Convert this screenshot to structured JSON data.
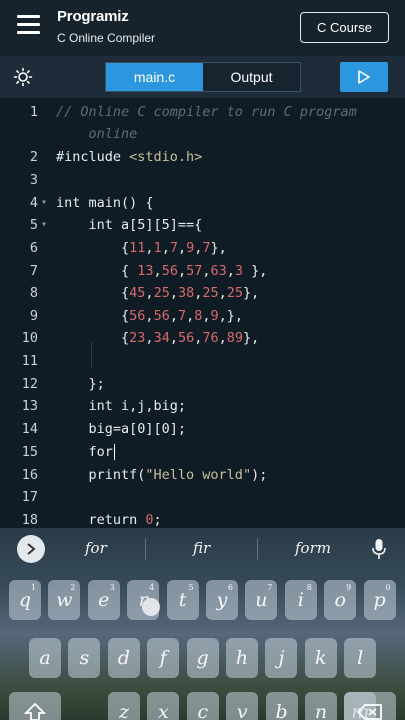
{
  "header": {
    "logo_text": "Programiz",
    "title": "C Online Compiler",
    "course_button": "C Course"
  },
  "toolbar": {
    "theme_icon": "sun-icon",
    "tabs": [
      {
        "label": "main.c",
        "active": true
      },
      {
        "label": "Output",
        "active": false
      }
    ],
    "run_icon": "play-icon",
    "accent_color": "#2c97de"
  },
  "editor": {
    "lines": [
      {
        "num": "1",
        "text": "// Online C compiler to run C program"
      },
      {
        "num": "",
        "text": "    online"
      },
      {
        "num": "2",
        "text": "#include <stdio.h>"
      },
      {
        "num": "3",
        "text": ""
      },
      {
        "num": "4",
        "text": "int main() {"
      },
      {
        "num": "5",
        "text": "    int a[5][5]=={"
      },
      {
        "num": "6",
        "text": "        {11,1,7,9,7},"
      },
      {
        "num": "7",
        "text": "        { 13,56,57,63,3 },"
      },
      {
        "num": "8",
        "text": "        {45,25,38,25,25},"
      },
      {
        "num": "9",
        "text": "        {56,56,7,8,9,},"
      },
      {
        "num": "10",
        "text": "        {23,34,56,76,89},"
      },
      {
        "num": "11",
        "text": ""
      },
      {
        "num": "12",
        "text": "    };"
      },
      {
        "num": "13",
        "text": "    int i,j,big;"
      },
      {
        "num": "14",
        "text": "    big=a[0][0];"
      },
      {
        "num": "15",
        "text": "    for"
      },
      {
        "num": "16",
        "text": "    printf(\"Hello world\");"
      },
      {
        "num": "17",
        "text": ""
      },
      {
        "num": "18",
        "text": "    return 0;"
      }
    ]
  },
  "keyboard": {
    "suggestions": [
      "for",
      "fir",
      "form"
    ],
    "row1": [
      {
        "k": "q",
        "h": "1"
      },
      {
        "k": "w",
        "h": "2"
      },
      {
        "k": "e",
        "h": "3"
      },
      {
        "k": "r",
        "h": "4"
      },
      {
        "k": "t",
        "h": "5"
      },
      {
        "k": "y",
        "h": "6"
      },
      {
        "k": "u",
        "h": "7"
      },
      {
        "k": "i",
        "h": "8"
      },
      {
        "k": "o",
        "h": "9"
      },
      {
        "k": "p",
        "h": "0"
      }
    ],
    "row2": [
      "a",
      "s",
      "d",
      "f",
      "g",
      "h",
      "j",
      "k",
      "l"
    ],
    "row3": [
      "z",
      "x",
      "c",
      "v",
      "b",
      "n",
      "m"
    ]
  }
}
